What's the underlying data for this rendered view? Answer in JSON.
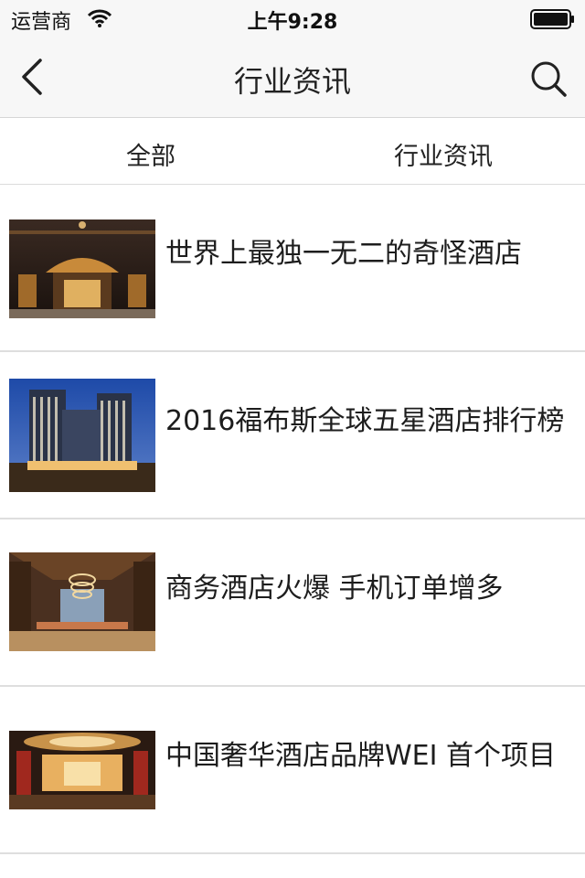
{
  "status_bar": {
    "carrier": "运营商",
    "time": "上午9:28"
  },
  "nav": {
    "title": "行业资讯"
  },
  "tabs": [
    {
      "label": "全部"
    },
    {
      "label": "行业资讯"
    }
  ],
  "articles": [
    {
      "title": "世界上最独一无二的奇怪酒店"
    },
    {
      "title": "2016福布斯全球五星酒店排行榜"
    },
    {
      "title": "商务酒店火爆 手机订单增多"
    },
    {
      "title": "中国奢华酒店品牌WEI 首个项目"
    }
  ]
}
